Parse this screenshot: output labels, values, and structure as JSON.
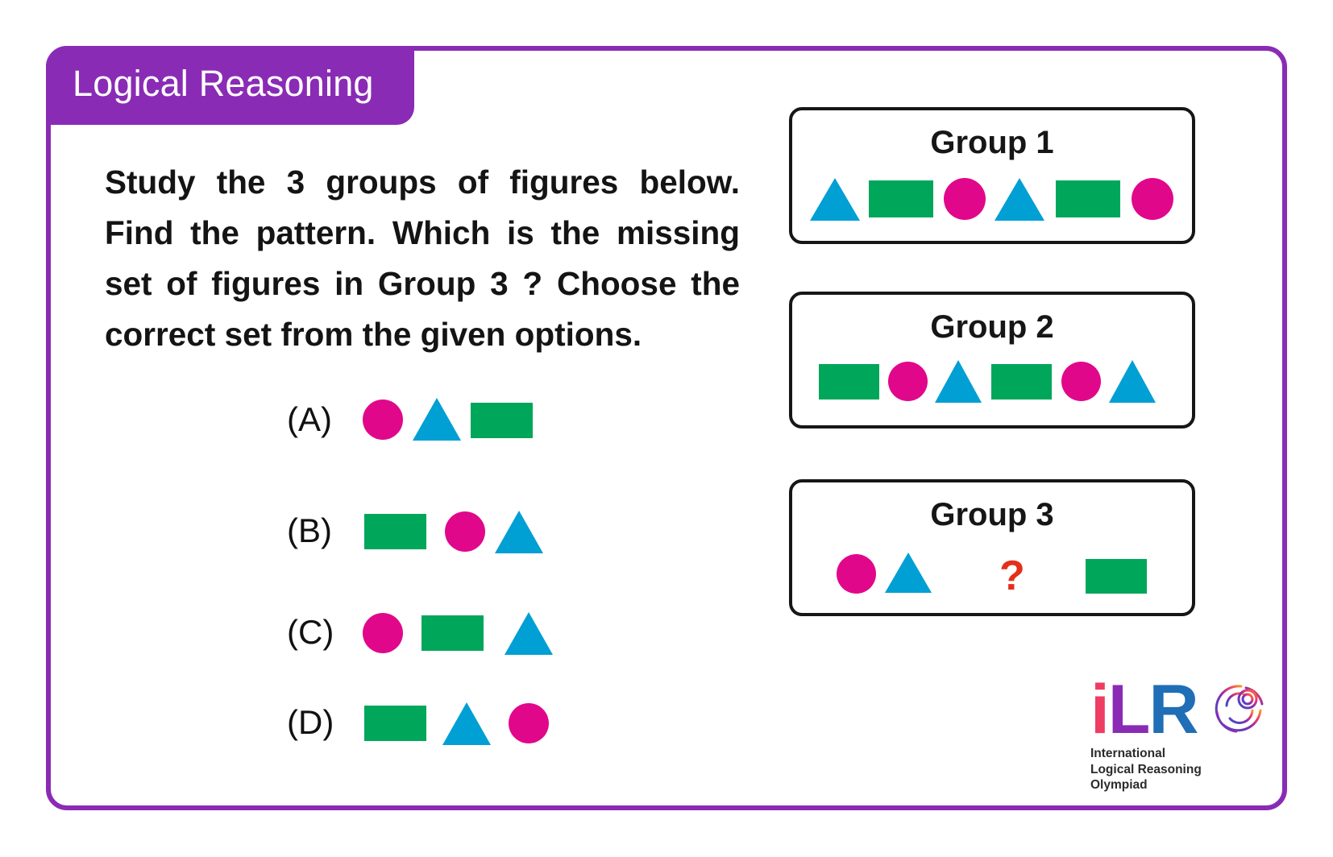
{
  "header": {
    "title": "Logical Reasoning"
  },
  "question": {
    "text": "Study the 3 groups of figures below. Find the pattern. Which is the missing set of figures in Group 3 ? Choose the correct set from the given options."
  },
  "colors": {
    "brand_purple": "#8a2bb5",
    "circle_magenta": "#e1078a",
    "rect_green": "#00a65a",
    "triangle_blue": "#009fd4",
    "question_mark_red": "#e3301b"
  },
  "options": [
    {
      "label": "(A)",
      "shapes": [
        "circle",
        "triangle",
        "rectangle"
      ]
    },
    {
      "label": "(B)",
      "shapes": [
        "rectangle",
        "circle",
        "triangle"
      ]
    },
    {
      "label": "(C)",
      "shapes": [
        "circle",
        "rectangle",
        "triangle"
      ]
    },
    {
      "label": "(D)",
      "shapes": [
        "rectangle",
        "triangle",
        "circle"
      ]
    }
  ],
  "groups": [
    {
      "title": "Group 1",
      "shapes": [
        "triangle",
        "rectangle",
        "circle",
        "triangle",
        "rectangle",
        "circle"
      ]
    },
    {
      "title": "Group 2",
      "shapes": [
        "rectangle",
        "circle",
        "triangle",
        "rectangle",
        "circle",
        "triangle"
      ]
    },
    {
      "title": "Group 3",
      "shapes": [
        "circle",
        "triangle",
        "missing",
        "rectangle"
      ],
      "missing_marker": "?"
    }
  ],
  "logo": {
    "letters": [
      "i",
      "L",
      "R",
      "O"
    ],
    "lines": [
      "International",
      "Logical Reasoning",
      "Olympiad"
    ]
  }
}
